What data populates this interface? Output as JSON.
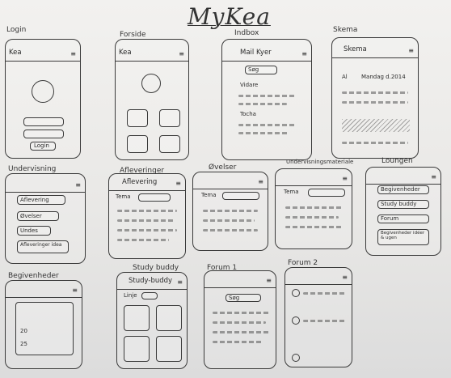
{
  "title": "MyKea",
  "screens": {
    "login": {
      "label": "Login",
      "app": "Kea",
      "button": "Login"
    },
    "forside": {
      "label": "Forside",
      "app": "Kea"
    },
    "indbox": {
      "label": "Indbox",
      "header": "Mail Kyer",
      "search": "Søg",
      "rows": [
        "Vidare",
        "Tocha"
      ]
    },
    "skema": {
      "label": "Skema",
      "header": "Skema",
      "date": "Mandag d.2014",
      "day": "Al"
    },
    "undervisning": {
      "label": "Undervisning",
      "items": [
        "Aflevering",
        "Øvelser",
        "Undes",
        "Afleveringer idea"
      ]
    },
    "afleveringer": {
      "label": "Afleveringer",
      "header": "Aflevering",
      "tema": "Tema"
    },
    "ovelser": {
      "label": "Øvelser",
      "tema": "Tema"
    },
    "undervisningsmateriale": {
      "label": "Undervisningsmateriale",
      "tema": "Tema"
    },
    "loungen": {
      "label": "Loungen",
      "items": [
        "Begivenheder",
        "Study buddy",
        "Forum",
        "Begivenheder idéer & ugen"
      ]
    },
    "begivenheder": {
      "label": "Begivenheder",
      "rows": [
        "20",
        "25"
      ]
    },
    "studybuddy": {
      "label": "Study buddy",
      "header": "Study-buddy",
      "field": "Linje"
    },
    "forum1": {
      "label": "Forum 1",
      "search": "Søg"
    },
    "forum2": {
      "label": "Forum 2"
    }
  }
}
